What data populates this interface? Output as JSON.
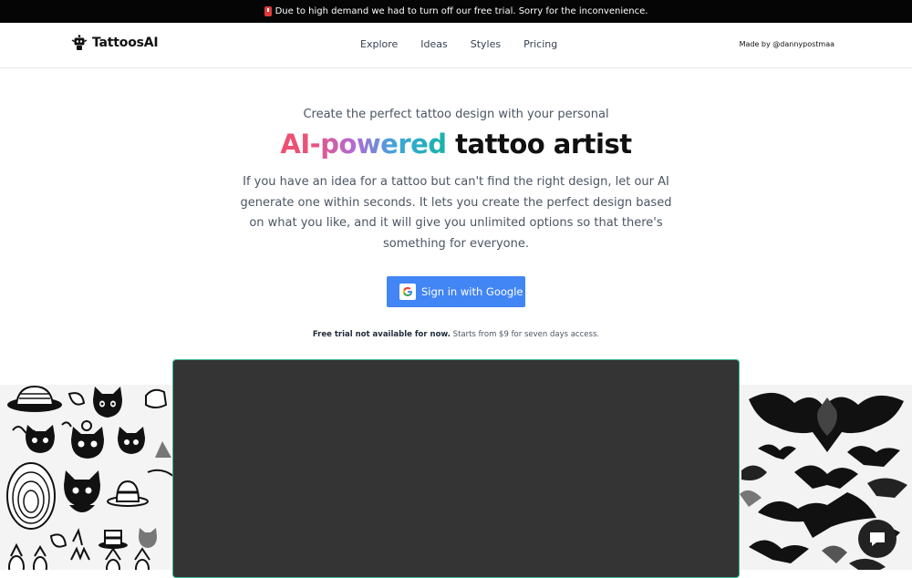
{
  "banner": {
    "icon": "alert-icon",
    "text": "Due to high demand we had to turn off our free trial. Sorry for the inconvenience."
  },
  "nav": {
    "logo_text": "TattoosAI",
    "logo_icon": "robot-icon",
    "links": [
      "Explore",
      "Ideas",
      "Styles",
      "Pricing"
    ],
    "made_by": "Made by @dannypostmaa"
  },
  "hero": {
    "tagline": "Create the perfect tattoo design with your personal",
    "headline_highlight": "AI-powered",
    "headline_rest": "tattoo artist",
    "description": "If you have an idea for a tattoo but can't find the right design, let our AI generate one within seconds. It lets you create the perfect design based on what you like, and it will give you unlimited options so that there's something for everyone."
  },
  "cta": {
    "google_label": "Sign in with Google",
    "google_icon": "google-icon",
    "button_color": "#4285f4"
  },
  "trial_note": {
    "bold": "Free trial not available for now.",
    "rest": "Starts from $9 for seven days access."
  },
  "chat": {
    "icon": "chat-bubble-icon"
  }
}
